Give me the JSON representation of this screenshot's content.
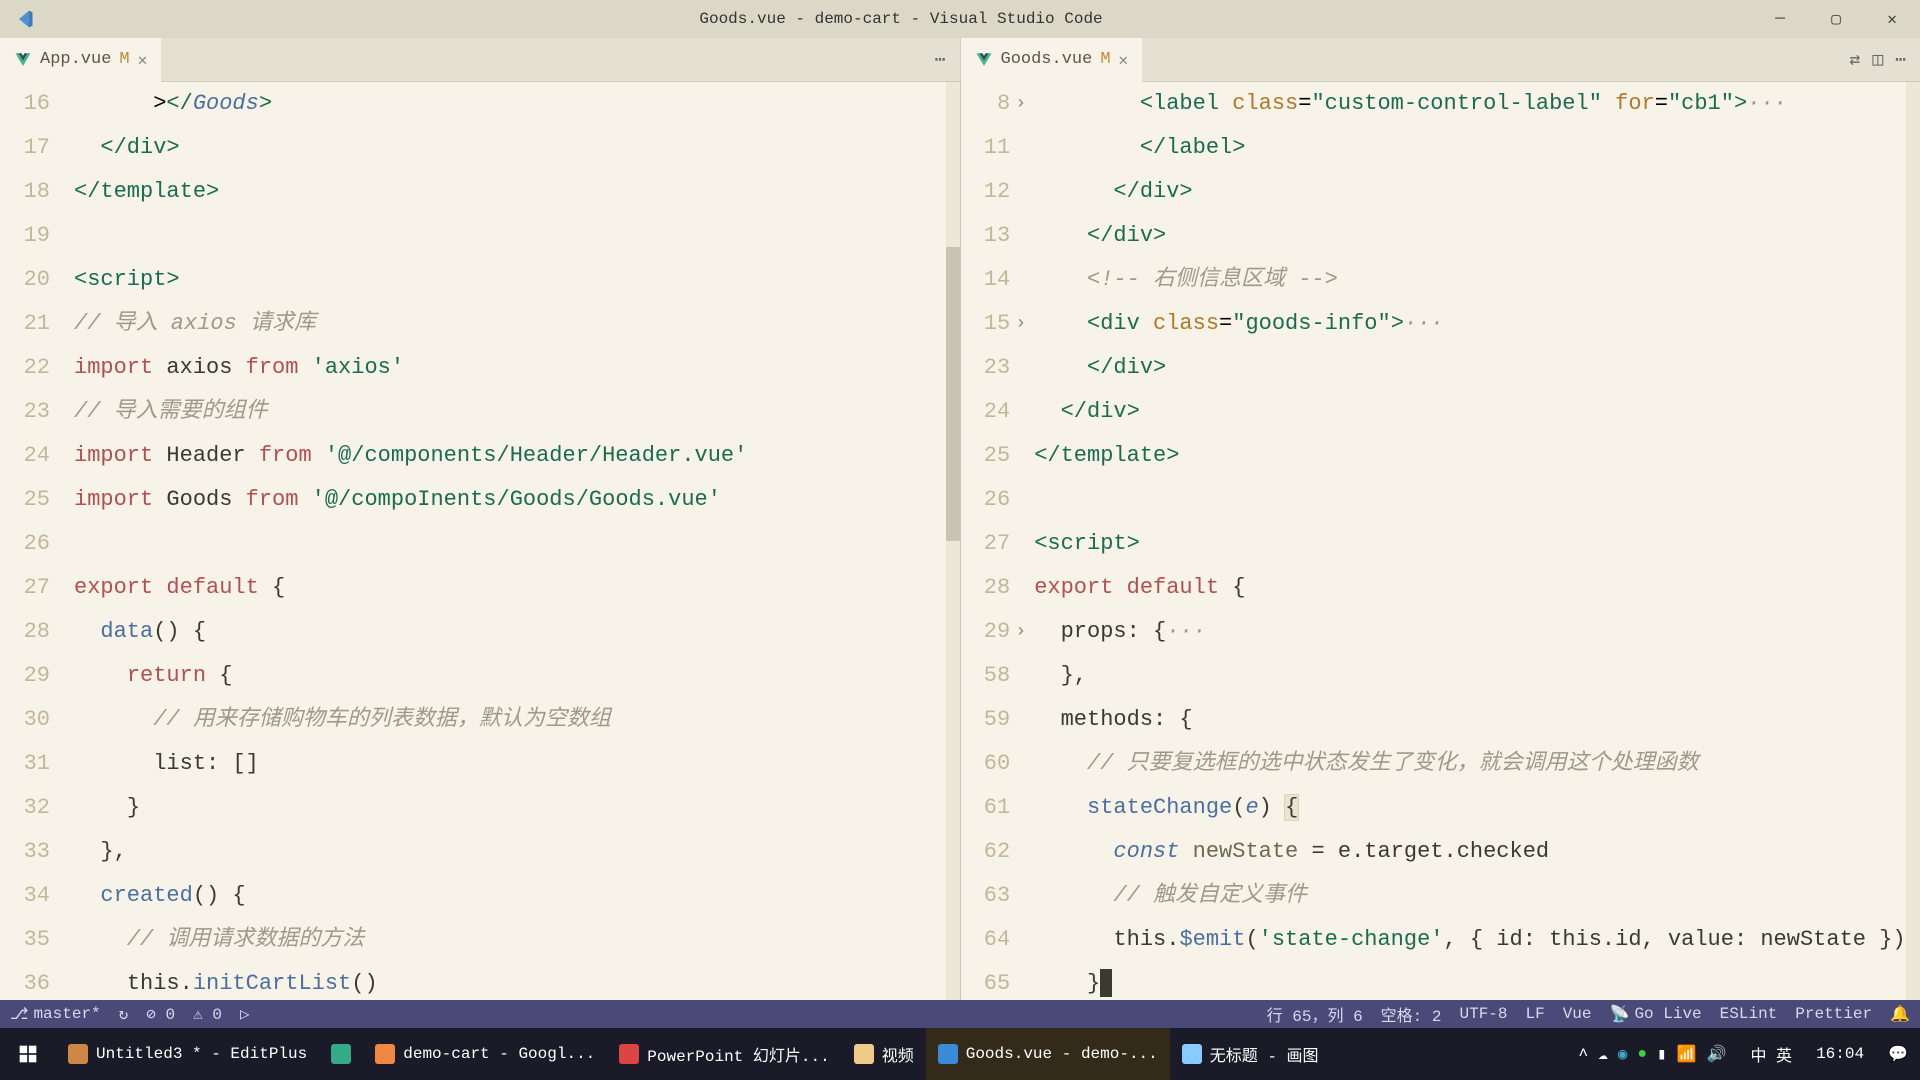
{
  "window": {
    "title": "Goods.vue - demo-cart - Visual Studio Code"
  },
  "tabs": {
    "left": {
      "name": "App.vue",
      "mod": "M"
    },
    "right": {
      "name": "Goods.vue",
      "mod": "M"
    }
  },
  "leftEditor": {
    "lines": [
      {
        "n": 16,
        "indent": 3,
        "html": "><span class='c-tag'>&lt;/</span><span class='c-type'>Goods</span><span class='c-tag'>&gt;</span>"
      },
      {
        "n": 17,
        "indent": 1,
        "html": "<span class='c-tag'>&lt;/div&gt;</span>"
      },
      {
        "n": 18,
        "indent": 0,
        "html": "<span class='c-tag'>&lt;/template&gt;</span>"
      },
      {
        "n": 19,
        "indent": 0,
        "html": ""
      },
      {
        "n": 20,
        "indent": 0,
        "html": "<span class='c-tag'>&lt;script&gt;</span>"
      },
      {
        "n": 21,
        "indent": 0,
        "html": "<span class='c-comment'>// 导入 axios 请求库</span>"
      },
      {
        "n": 22,
        "indent": 0,
        "html": "<span class='c-kw'>import</span> <span class='c-text'>axios</span> <span class='c-kw'>from</span> <span class='c-str'>'axios'</span>"
      },
      {
        "n": 23,
        "indent": 0,
        "html": "<span class='c-comment'>// 导入需要的组件</span>"
      },
      {
        "n": 24,
        "indent": 0,
        "html": "<span class='c-kw'>import</span> <span class='c-text'>Header</span> <span class='c-kw'>from</span> <span class='c-str'>'@/components/Header/Header.vue'</span>"
      },
      {
        "n": 25,
        "indent": 0,
        "html": "<span class='c-kw'>import</span> <span class='c-text'>Goods</span> <span class='c-kw'>from</span> <span class='c-str'>'@/compo<span style='font-style:normal'>I</span>nents/Goods/Goods.vue'</span>"
      },
      {
        "n": 26,
        "indent": 0,
        "html": ""
      },
      {
        "n": 27,
        "indent": 0,
        "html": "<span class='c-kw'>export</span> <span class='c-kw'>default</span> <span class='c-text'>{</span>"
      },
      {
        "n": 28,
        "indent": 1,
        "html": "<span class='c-fn'>data</span><span class='c-text'>() {</span>"
      },
      {
        "n": 29,
        "indent": 2,
        "html": "<span class='c-kw'>return</span> <span class='c-text'>{</span>"
      },
      {
        "n": 30,
        "indent": 3,
        "html": "<span class='c-comment'>// 用来存储购物车的列表数据，默认为空数组</span>"
      },
      {
        "n": 31,
        "indent": 3,
        "html": "<span class='c-text'>list: []</span>"
      },
      {
        "n": 32,
        "indent": 2,
        "html": "<span class='c-text'>}</span>"
      },
      {
        "n": 33,
        "indent": 1,
        "html": "<span class='c-text'>},</span>"
      },
      {
        "n": 34,
        "indent": 1,
        "html": "<span class='c-fn'>created</span><span class='c-text'>() {</span>"
      },
      {
        "n": 35,
        "indent": 2,
        "html": "<span class='c-comment'>// 调用请求数据的方法</span>"
      },
      {
        "n": 36,
        "indent": 2,
        "html": "<span class='c-text'>this.</span><span class='c-fn'>initCartList</span><span class='c-text'>()</span>"
      }
    ]
  },
  "rightEditor": {
    "lines": [
      {
        "n": 8,
        "fold": ">",
        "indent": 4,
        "html": "<span class='c-tag'>&lt;label</span> <span class='c-attr'>class</span>=<span class='c-str'>\"custom-control-label\"</span> <span class='c-attr'>for</span>=<span class='c-str'>\"cb1\"</span><span class='c-tag'>&gt;</span><span class='c-comment'>···</span>"
      },
      {
        "n": 11,
        "indent": 4,
        "html": "<span class='c-tag'>&lt;/label&gt;</span>"
      },
      {
        "n": 12,
        "indent": 3,
        "html": "<span class='c-tag'>&lt;/div&gt;</span>"
      },
      {
        "n": 13,
        "indent": 2,
        "html": "<span class='c-tag'>&lt;/div&gt;</span>"
      },
      {
        "n": 14,
        "indent": 2,
        "html": "<span class='c-comment'>&lt;!-- 右侧信息区域 --&gt;</span>"
      },
      {
        "n": 15,
        "fold": ">",
        "indent": 2,
        "html": "<span class='c-tag'>&lt;div</span> <span class='c-attr'>class</span>=<span class='c-str'>\"goods-info\"</span><span class='c-tag'>&gt;</span><span class='c-comment'>···</span>"
      },
      {
        "n": 23,
        "indent": 2,
        "html": "<span class='c-tag'>&lt;/div&gt;</span>"
      },
      {
        "n": 24,
        "indent": 1,
        "html": "<span class='c-tag'>&lt;/div&gt;</span>"
      },
      {
        "n": 25,
        "indent": 0,
        "html": "<span class='c-tag'>&lt;/template&gt;</span>"
      },
      {
        "n": 26,
        "indent": 0,
        "html": ""
      },
      {
        "n": 27,
        "indent": 0,
        "html": "<span class='c-tag'>&lt;script&gt;</span>"
      },
      {
        "n": 28,
        "indent": 0,
        "html": "<span class='c-kw'>export</span> <span class='c-kw'>default</span> <span class='c-text'>{</span>"
      },
      {
        "n": 29,
        "fold": ">",
        "indent": 1,
        "html": "<span class='c-text'>props: {</span><span class='c-comment'>···</span>"
      },
      {
        "n": 58,
        "indent": 1,
        "html": "<span class='c-text'>},</span>"
      },
      {
        "n": 59,
        "indent": 1,
        "html": "<span class='c-text'>methods: {</span>"
      },
      {
        "n": 60,
        "indent": 2,
        "html": "<span class='c-comment'>// 只要复选框的选中状态发生了变化，就会调用这个处理函数</span>"
      },
      {
        "n": 61,
        "indent": 2,
        "html": "<span class='c-fn'>stateChange</span><span class='c-text'>(</span><span class='c-type'>e</span><span class='c-text'>) <span class='sel-hint'>{</span></span>"
      },
      {
        "n": 62,
        "indent": 3,
        "html": "<span class='c-type'>const</span> <span class='c-var'>newState</span> <span class='c-text'>= e.target.checked</span>"
      },
      {
        "n": 63,
        "indent": 3,
        "html": "<span class='c-comment'>// 触发自定义事件</span>"
      },
      {
        "n": 64,
        "indent": 3,
        "html": "<span class='c-text'>this.</span><span class='c-fn'>$emit</span><span class='c-text'>(</span><span class='c-str'>'state-change'</span><span class='c-text'>, { id: this.id, value: newState })</span>"
      },
      {
        "n": 65,
        "indent": 2,
        "cursor": true,
        "html": "<span class='c-text'>}</span>"
      }
    ]
  },
  "statusBar": {
    "branch": "master*",
    "sync": "↻",
    "errors": "⊘ 0",
    "warnings": "⚠ 0",
    "lineCol": "行 65，列 6",
    "spaces": "空格: 2",
    "encoding": "UTF-8",
    "eol": "LF",
    "lang": "Vue",
    "goLive": "Go Live",
    "eslint": "ESLint",
    "prettier": "Prettier"
  },
  "taskbar": {
    "items": [
      {
        "label": "Untitled3 * - EditPlus",
        "icon": "editplus"
      },
      {
        "label": "",
        "icon": "edge"
      },
      {
        "label": "demo-cart - Googl...",
        "icon": "chrome"
      },
      {
        "label": "PowerPoint 幻灯片...",
        "icon": "ppt"
      },
      {
        "label": "视频",
        "icon": "folder"
      },
      {
        "label": "Goods.vue - demo-...",
        "icon": "vscode",
        "active": true
      },
      {
        "label": "无标题 - 画图",
        "icon": "paint"
      }
    ],
    "ime": "中 英",
    "time": "16:04"
  }
}
